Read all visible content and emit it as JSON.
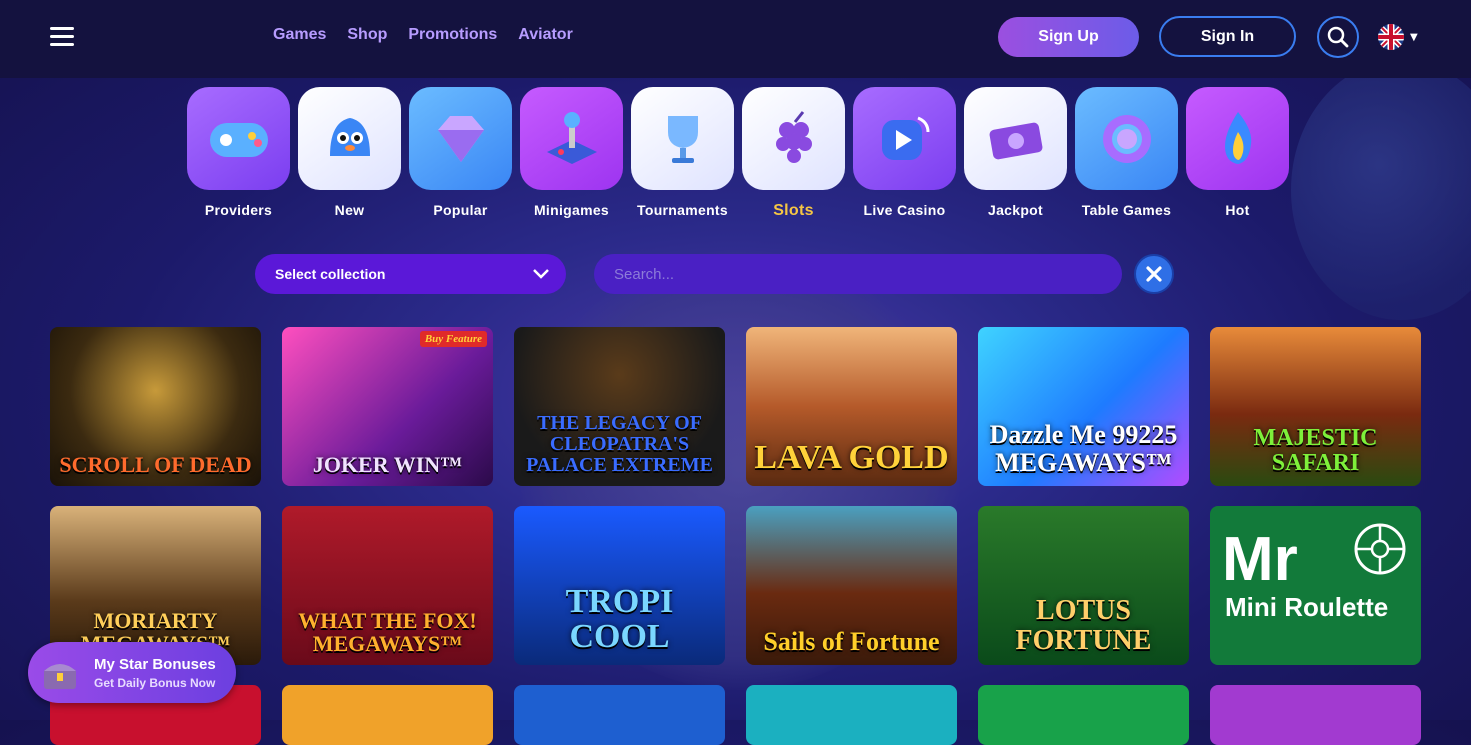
{
  "header": {
    "nav": [
      "Games",
      "Shop",
      "Promotions",
      "Aviator"
    ],
    "signup_label": "Sign Up",
    "signin_label": "Sign In"
  },
  "categories": [
    {
      "label": "Providers",
      "icon": "gamepad-icon"
    },
    {
      "label": "New",
      "icon": "bell-icon"
    },
    {
      "label": "Popular",
      "icon": "diamond-icon"
    },
    {
      "label": "Minigames",
      "icon": "joystick-icon"
    },
    {
      "label": "Tournaments",
      "icon": "trophy-icon"
    },
    {
      "label": "Slots",
      "icon": "grapes-icon",
      "active": true
    },
    {
      "label": "Live Casino",
      "icon": "play-icon"
    },
    {
      "label": "Jackpot",
      "icon": "cash-icon"
    },
    {
      "label": "Table Games",
      "icon": "chip-icon"
    },
    {
      "label": "Hot",
      "icon": "flame-icon"
    }
  ],
  "filters": {
    "collection_label": "Select collection",
    "search_placeholder": "Search..."
  },
  "games": [
    {
      "title": "SCROLL OF DEAD"
    },
    {
      "title": "JOKER WIN™",
      "badge": "Buy Feature"
    },
    {
      "title": "THE LEGACY OF CLEOPATRA'S PALACE EXTREME"
    },
    {
      "title": "LAVA GOLD"
    },
    {
      "title": "Dazzle Me 99225 MEGAWAYS™"
    },
    {
      "title": "MAJESTIC SAFARI"
    },
    {
      "title": "MORIARTY MEGAWAYS™"
    },
    {
      "title": "WHAT THE FOX! MEGAWAYS™"
    },
    {
      "title": "TROPI COOL"
    },
    {
      "title": "Sails of Fortune"
    },
    {
      "title": "LOTUS FORTUNE"
    },
    {
      "title": "Mini Roulette",
      "abbr": "Mr"
    }
  ],
  "bonus": {
    "title": "My Star Bonuses",
    "subtitle": "Get Daily Bonus Now"
  },
  "colors": {
    "header_bg": "#14123f",
    "accent_purple": "#5b18d8",
    "active_gold": "#f6c644",
    "nav_text": "#b79cff",
    "button_blue": "#3a7df0"
  }
}
